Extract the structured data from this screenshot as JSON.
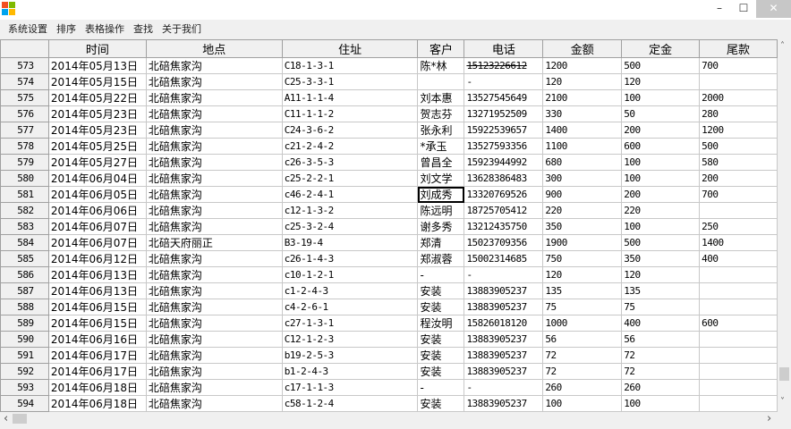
{
  "window": {
    "minimize": "–",
    "maximize": "☐",
    "close": "✕"
  },
  "menu": [
    "系统设置",
    "排序",
    "表格操作",
    "查找",
    "关于我们"
  ],
  "columns": [
    "",
    "时间",
    "地点",
    "住址",
    "客户",
    "电话",
    "金额",
    "定金",
    "尾款"
  ],
  "rows": [
    [
      "573",
      "2014年05月13日",
      "北碚焦家沟",
      "C18-1-3-1",
      "陈*林",
      "15123226612",
      "1200",
      "500",
      "700"
    ],
    [
      "574",
      "2014年05月15日",
      "北碚焦家沟",
      "C25-3-3-1",
      "",
      "-",
      "120",
      "120",
      ""
    ],
    [
      "575",
      "2014年05月22日",
      "北碚焦家沟",
      "A11-1-1-4",
      "刘本惠",
      "13527545649",
      "2100",
      "100",
      "2000"
    ],
    [
      "576",
      "2014年05月23日",
      "北碚焦家沟",
      "C11-1-1-2",
      "贺志芬",
      "13271952509",
      "330",
      "50",
      "280"
    ],
    [
      "577",
      "2014年05月23日",
      "北碚焦家沟",
      "C24-3-6-2",
      "张永利",
      "15922539657",
      "1400",
      "200",
      "1200"
    ],
    [
      "578",
      "2014年05月25日",
      "北碚焦家沟",
      "c21-2-4-2",
      "*承玉",
      "13527593356",
      "1100",
      "600",
      "500"
    ],
    [
      "579",
      "2014年05月27日",
      "北碚焦家沟",
      "c26-3-5-3",
      "曾昌全",
      "15923944992",
      "680",
      "100",
      "580"
    ],
    [
      "580",
      "2014年06月04日",
      "北碚焦家沟",
      "c25-2-2-1",
      "刘文学",
      "13628386483",
      "300",
      "100",
      "200"
    ],
    [
      "581",
      "2014年06月05日",
      "北碚焦家沟",
      "c46-2-4-1",
      "刘成秀",
      "13320769526",
      "900",
      "200",
      "700"
    ],
    [
      "582",
      "2014年06月06日",
      "北碚焦家沟",
      "c12-1-3-2",
      "陈远明",
      "18725705412",
      "220",
      "220",
      ""
    ],
    [
      "583",
      "2014年06月07日",
      "北碚焦家沟",
      "c25-3-2-4",
      "谢多秀",
      "13212435750",
      "350",
      "100",
      "250"
    ],
    [
      "584",
      "2014年06月07日",
      "北碚天府丽正",
      "B3-19-4",
      "郑清",
      "15023709356",
      "1900",
      "500",
      "1400"
    ],
    [
      "585",
      "2014年06月12日",
      "北碚焦家沟",
      "c26-1-4-3",
      "郑淑蓉",
      "15002314685",
      "750",
      "350",
      "400"
    ],
    [
      "586",
      "2014年06月13日",
      "北碚焦家沟",
      "c10-1-2-1",
      "-",
      "-",
      "120",
      "120",
      ""
    ],
    [
      "587",
      "2014年06月13日",
      "北碚焦家沟",
      "c1-2-4-3",
      "安装",
      "13883905237",
      "135",
      "135",
      ""
    ],
    [
      "588",
      "2014年06月15日",
      "北碚焦家沟",
      "c4-2-6-1",
      "安装",
      "13883905237",
      "75",
      "75",
      ""
    ],
    [
      "589",
      "2014年06月15日",
      "北碚焦家沟",
      "c27-1-3-1",
      "程汝明",
      "15826018120",
      "1000",
      "400",
      "600"
    ],
    [
      "590",
      "2014年06月16日",
      "北碚焦家沟",
      "C12-1-2-3",
      "安装",
      "13883905237",
      "56",
      "56",
      ""
    ],
    [
      "591",
      "2014年06月17日",
      "北碚焦家沟",
      "b19-2-5-3",
      "安装",
      "13883905237",
      "72",
      "72",
      ""
    ],
    [
      "592",
      "2014年06月17日",
      "北碚焦家沟",
      "b1-2-4-3",
      "安装",
      "13883905237",
      "72",
      "72",
      ""
    ],
    [
      "593",
      "2014年06月18日",
      "北碚焦家沟",
      "c17-1-1-3",
      "-",
      "-",
      "260",
      "260",
      ""
    ],
    [
      "594",
      "2014年06月18日",
      "北碚焦家沟",
      "c58-1-2-4",
      "安装",
      "13883905237",
      "100",
      "100",
      ""
    ]
  ],
  "scroll": {
    "up": "˄",
    "down": "˅",
    "left": "‹",
    "right": "›",
    "vertical_position": 0.95,
    "horizontal_position": 0.0
  }
}
